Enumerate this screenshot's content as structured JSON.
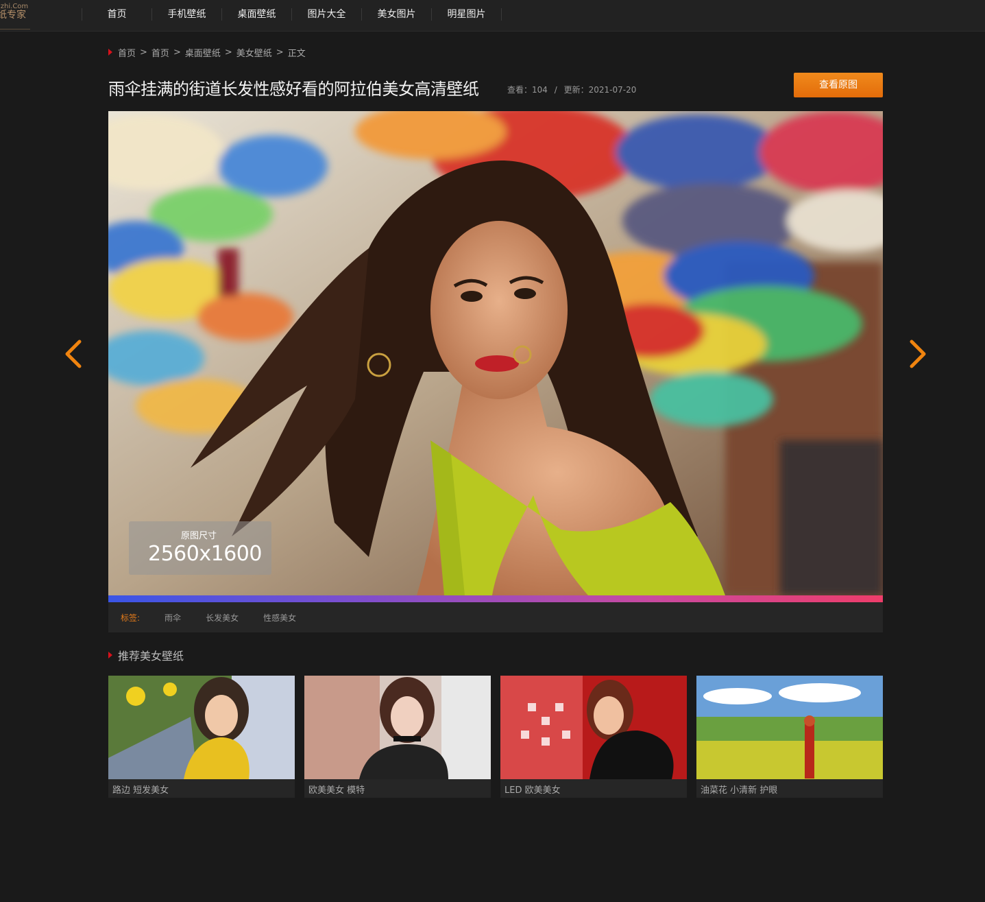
{
  "logo": {
    "line1": "izhi.Com",
    "line2": "纸专家"
  },
  "nav": {
    "items": [
      {
        "label": "首页"
      },
      {
        "label": "手机壁纸"
      },
      {
        "label": "桌面壁纸"
      },
      {
        "label": "图片大全"
      },
      {
        "label": "美女图片"
      },
      {
        "label": "明星图片"
      }
    ]
  },
  "breadcrumb": {
    "items": [
      "首页",
      "首页",
      "桌面壁纸",
      "美女壁纸"
    ],
    "current": "正文",
    "separator": ">"
  },
  "page": {
    "title": "雨伞挂满的街道长发性感好看的阿拉伯美女高清壁纸",
    "views_label": "查看：",
    "views": "104",
    "divider": "/",
    "updated_label": "更新：",
    "updated": "2021-07-20",
    "view_original_button": "查看原图"
  },
  "image": {
    "size_label": "原图尺寸",
    "size_value": "2560x1600"
  },
  "tags": {
    "label": "标签:",
    "items": [
      "雨伞",
      "长发美女",
      "性感美女"
    ]
  },
  "recommend": {
    "heading": "推荐美女壁纸",
    "items": [
      {
        "caption": "路边 短发美女"
      },
      {
        "caption": "欧美美女 模特"
      },
      {
        "caption": "LED 欧美美女"
      },
      {
        "caption": "油菜花 小清新 护眼"
      }
    ]
  },
  "colors": {
    "accent": "#e36c0a",
    "tag_label": "#e47b1a",
    "breadcrumb_marker": "#d7111b",
    "background": "#1a1a1a"
  },
  "icons": {
    "prev": "chevron-left-icon",
    "next": "chevron-right-icon"
  }
}
